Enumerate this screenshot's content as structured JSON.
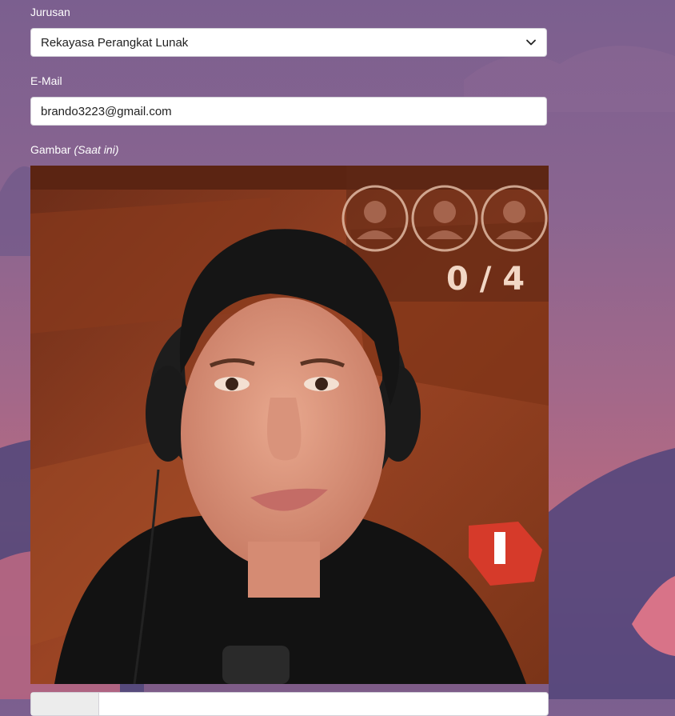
{
  "form": {
    "jurusan": {
      "label": "Jurusan",
      "value": "Rekayasa Perangkat Lunak"
    },
    "email": {
      "label": "E-Mail",
      "value": "brando3223@gmail.com"
    },
    "gambar": {
      "label": "Gambar",
      "label_note": "(Saat ini)"
    },
    "photo": {
      "counter_text": "0 / 4"
    }
  },
  "icons": {
    "dropdown": "chevron-down-icon"
  }
}
